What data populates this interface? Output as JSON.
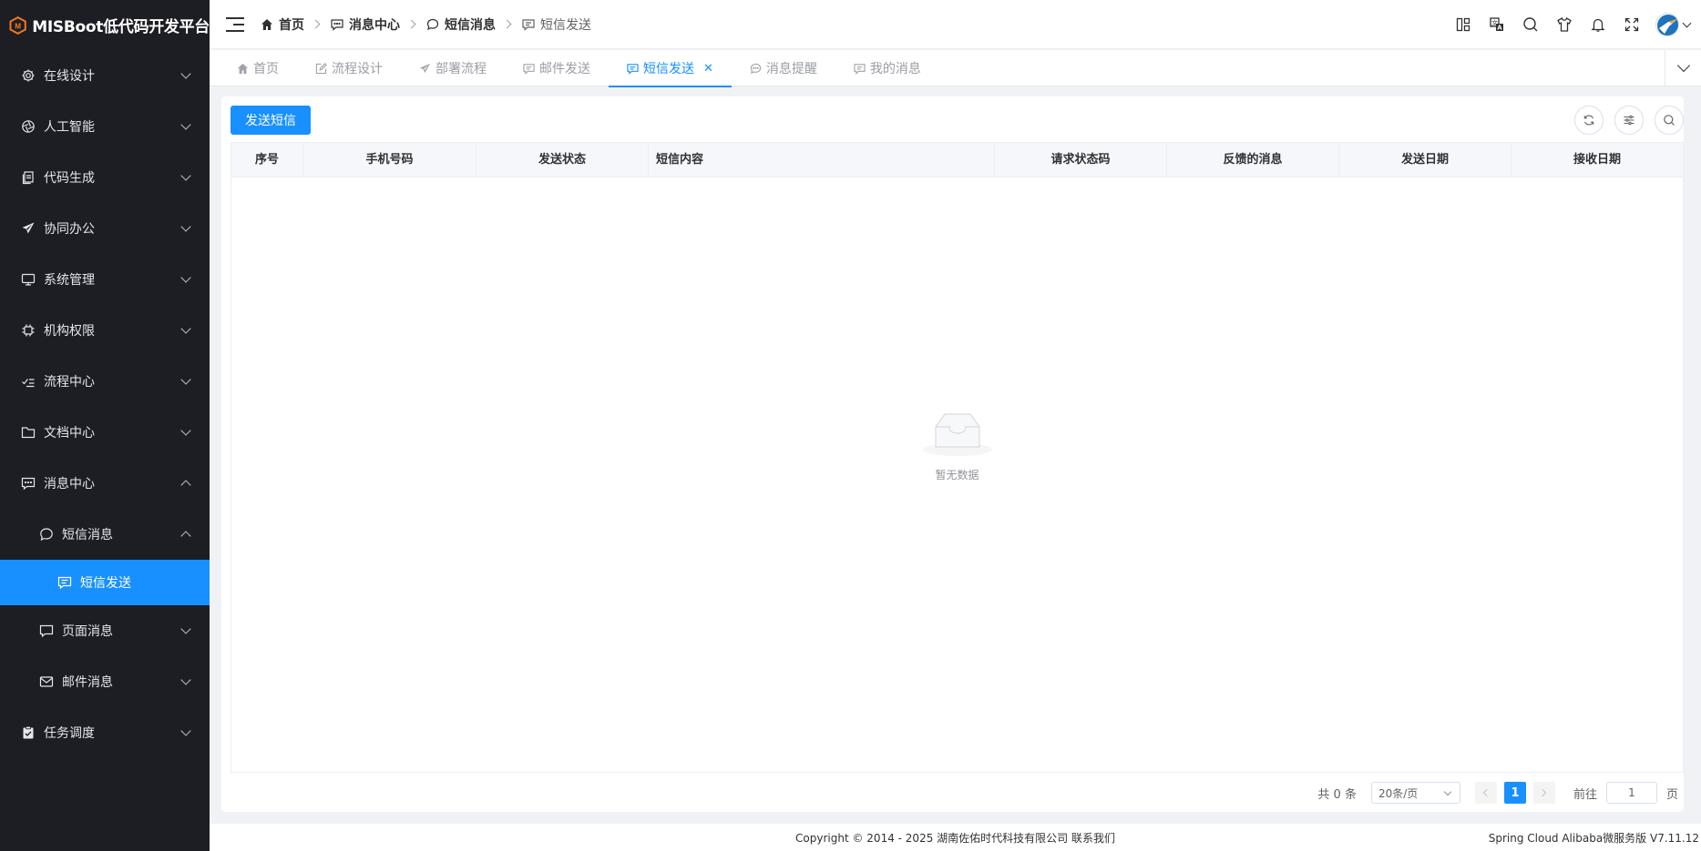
{
  "app": {
    "logo_text": "MISBoot低代码开发平台",
    "brand_color": "#f47a20"
  },
  "sidebar": {
    "items": [
      {
        "label": "在线设计",
        "icon": "gear-icon"
      },
      {
        "label": "人工智能",
        "icon": "aperture-icon"
      },
      {
        "label": "代码生成",
        "icon": "document-copy-icon"
      },
      {
        "label": "协同办公",
        "icon": "send-icon"
      },
      {
        "label": "系统管理",
        "icon": "monitor-icon"
      },
      {
        "label": "机构权限",
        "icon": "cpu-icon"
      },
      {
        "label": "流程中心",
        "icon": "checklist-icon"
      },
      {
        "label": "文档中心",
        "icon": "folder-icon"
      },
      {
        "label": "消息中心",
        "icon": "chat-square-icon"
      },
      {
        "label": "任务调度",
        "icon": "clipboard-check-icon"
      }
    ],
    "sub_items": [
      {
        "label": "短信消息",
        "icon": "chat-round-icon"
      },
      {
        "label": "页面消息",
        "icon": "chat-square-icon"
      },
      {
        "label": "邮件消息",
        "icon": "mail-icon"
      }
    ],
    "active_item": {
      "label": "短信发送",
      "icon": "chat-line-square-icon"
    },
    "active_color": "#1890ff"
  },
  "header": {
    "breadcrumb": [
      {
        "label": "首页",
        "icon": "home-icon"
      },
      {
        "label": "消息中心",
        "icon": "chat-dot-square-icon"
      },
      {
        "label": "短信消息",
        "icon": "chat-round-icon"
      },
      {
        "label": "短信发送",
        "icon": "chat-line-square-icon"
      }
    ],
    "tool_icons": [
      "grid-icon",
      "translate-icon",
      "search-icon",
      "shirt-icon",
      "bell-icon",
      "fullscreen-icon"
    ],
    "avatar_icon": "avatar-icon"
  },
  "tabs": [
    {
      "label": "首页",
      "icon": "home-icon",
      "active": false
    },
    {
      "label": "流程设计",
      "icon": "edit-icon",
      "active": false
    },
    {
      "label": "部署流程",
      "icon": "send-icon",
      "active": false
    },
    {
      "label": "邮件发送",
      "icon": "chat-line-square-icon",
      "active": false
    },
    {
      "label": "短信发送",
      "icon": "chat-line-square-icon",
      "active": true
    },
    {
      "label": "消息提醒",
      "icon": "chat-dot-round-icon",
      "active": false
    },
    {
      "label": "我的消息",
      "icon": "chat-line-square-icon",
      "active": false
    }
  ],
  "toolbar": {
    "send_label": "发送短信",
    "right_icons": [
      "refresh-icon",
      "filter-icon",
      "search-icon"
    ]
  },
  "table": {
    "columns": [
      "序号",
      "手机号码",
      "发送状态",
      "短信内容",
      "请求状态码",
      "反馈的消息",
      "发送日期",
      "接收日期"
    ],
    "rows": [],
    "empty_text": "暂无数据"
  },
  "pagination": {
    "total_text": "共 0 条",
    "page_size": "20条/页",
    "current_page": "1",
    "goto_label": "前往",
    "goto_value": "1",
    "page_unit": "页"
  },
  "footer": {
    "copyright": "Copyright © 2014 - 2025 湖南佐佑时代科技有限公司 联系我们",
    "version": "Spring Cloud Alibaba微服务版 V7.11.12"
  }
}
